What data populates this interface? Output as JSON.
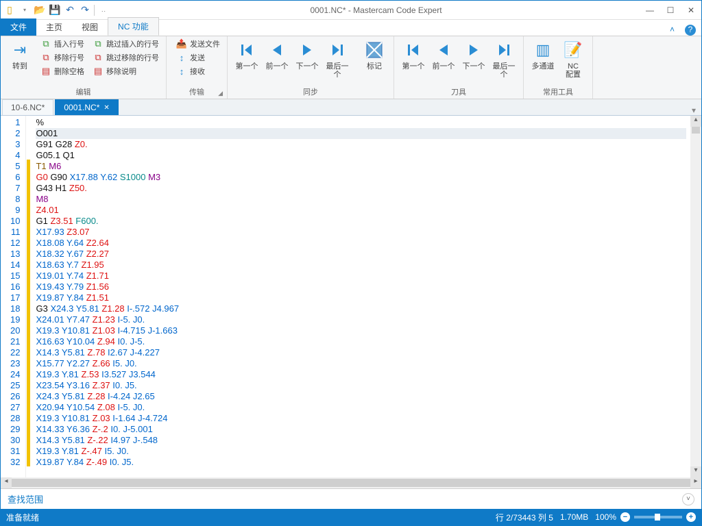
{
  "window": {
    "title": "0001.NC* - Mastercam Code Expert"
  },
  "ribbon_context_tab": "编辑",
  "ribbon_tabs": {
    "file": "文件",
    "home": "主页",
    "view": "视图",
    "nc": "NC 功能"
  },
  "ribbon": {
    "edit_group": {
      "label": "编辑",
      "goto": "转到",
      "insert_line": "插入行号",
      "skip_insert": "跳过插入的行号",
      "remove_line": "移除行号",
      "skip_remove": "跳过移除的行号",
      "remove_blank": "删除空格",
      "remove_comment": "移除说明"
    },
    "transfer_group": {
      "label": "传输",
      "send_file": "发送文件",
      "send": "发送",
      "receive": "接收"
    },
    "sync_group": {
      "label": "同步",
      "first": "第一个",
      "prev": "前一个",
      "next": "下一个",
      "last": "最后一个",
      "mark": "标记"
    },
    "tool_group": {
      "label": "刀具",
      "first": "第一个",
      "prev": "前一个",
      "next": "下一个",
      "last": "最后一个"
    },
    "common_group": {
      "label": "常用工具",
      "multichannel": "多通道",
      "nc_config": "NC\n配置"
    }
  },
  "doc_tabs": {
    "inactive": "10-6.NC*",
    "active": "0001.NC*"
  },
  "code_lines": [
    {
      "n": 1,
      "hl": false,
      "mk": false,
      "tokens": [
        {
          "t": "%",
          "c": ""
        }
      ]
    },
    {
      "n": 2,
      "hl": true,
      "mk": false,
      "tokens": [
        {
          "t": "O001",
          "c": ""
        }
      ]
    },
    {
      "n": 3,
      "hl": false,
      "mk": false,
      "tokens": [
        {
          "t": "G91 G28 ",
          "c": ""
        },
        {
          "t": "Z0.",
          "c": "red"
        }
      ]
    },
    {
      "n": 4,
      "hl": false,
      "mk": false,
      "tokens": [
        {
          "t": "G05.1 Q1",
          "c": ""
        }
      ]
    },
    {
      "n": 5,
      "hl": false,
      "mk": true,
      "tokens": [
        {
          "t": "T1 ",
          "c": "brown"
        },
        {
          "t": "M6",
          "c": "purple"
        }
      ]
    },
    {
      "n": 6,
      "hl": false,
      "mk": true,
      "tokens": [
        {
          "t": "G0 ",
          "c": "red"
        },
        {
          "t": "G90 ",
          "c": ""
        },
        {
          "t": "X17.88 Y.62 ",
          "c": "blue"
        },
        {
          "t": "S1000 ",
          "c": "teal"
        },
        {
          "t": "M3",
          "c": "purple"
        }
      ]
    },
    {
      "n": 7,
      "hl": false,
      "mk": true,
      "tokens": [
        {
          "t": "G43 H1 ",
          "c": ""
        },
        {
          "t": "Z50.",
          "c": "red"
        }
      ]
    },
    {
      "n": 8,
      "hl": false,
      "mk": true,
      "tokens": [
        {
          "t": "M8",
          "c": "purple"
        }
      ]
    },
    {
      "n": 9,
      "hl": false,
      "mk": true,
      "tokens": [
        {
          "t": "Z4.01",
          "c": "red"
        }
      ]
    },
    {
      "n": 10,
      "hl": false,
      "mk": true,
      "tokens": [
        {
          "t": "G1 ",
          "c": ""
        },
        {
          "t": "Z3.51 ",
          "c": "red"
        },
        {
          "t": "F600.",
          "c": "teal"
        }
      ]
    },
    {
      "n": 11,
      "hl": false,
      "mk": true,
      "tokens": [
        {
          "t": "X17.93 ",
          "c": "blue"
        },
        {
          "t": "Z3.07",
          "c": "red"
        }
      ]
    },
    {
      "n": 12,
      "hl": false,
      "mk": true,
      "tokens": [
        {
          "t": "X18.08 Y.64 ",
          "c": "blue"
        },
        {
          "t": "Z2.64",
          "c": "red"
        }
      ]
    },
    {
      "n": 13,
      "hl": false,
      "mk": true,
      "tokens": [
        {
          "t": "X18.32 Y.67 ",
          "c": "blue"
        },
        {
          "t": "Z2.27",
          "c": "red"
        }
      ]
    },
    {
      "n": 14,
      "hl": false,
      "mk": true,
      "tokens": [
        {
          "t": "X18.63 Y.7 ",
          "c": "blue"
        },
        {
          "t": "Z1.95",
          "c": "red"
        }
      ]
    },
    {
      "n": 15,
      "hl": false,
      "mk": true,
      "tokens": [
        {
          "t": "X19.01 Y.74 ",
          "c": "blue"
        },
        {
          "t": "Z1.71",
          "c": "red"
        }
      ]
    },
    {
      "n": 16,
      "hl": false,
      "mk": true,
      "tokens": [
        {
          "t": "X19.43 Y.79 ",
          "c": "blue"
        },
        {
          "t": "Z1.56",
          "c": "red"
        }
      ]
    },
    {
      "n": 17,
      "hl": false,
      "mk": true,
      "tokens": [
        {
          "t": "X19.87 Y.84 ",
          "c": "blue"
        },
        {
          "t": "Z1.51",
          "c": "red"
        }
      ]
    },
    {
      "n": 18,
      "hl": false,
      "mk": true,
      "tokens": [
        {
          "t": "G3 ",
          "c": ""
        },
        {
          "t": "X24.3 Y5.81 ",
          "c": "blue"
        },
        {
          "t": "Z1.28 ",
          "c": "red"
        },
        {
          "t": "I-.572 J4.967",
          "c": "blue"
        }
      ]
    },
    {
      "n": 19,
      "hl": false,
      "mk": true,
      "tokens": [
        {
          "t": "X24.01 Y7.47 ",
          "c": "blue"
        },
        {
          "t": "Z1.23 ",
          "c": "red"
        },
        {
          "t": "I-5. J0.",
          "c": "blue"
        }
      ]
    },
    {
      "n": 20,
      "hl": false,
      "mk": true,
      "tokens": [
        {
          "t": "X19.3 Y10.81 ",
          "c": "blue"
        },
        {
          "t": "Z1.03 ",
          "c": "red"
        },
        {
          "t": "I-4.715 J-1.663",
          "c": "blue"
        }
      ]
    },
    {
      "n": 21,
      "hl": false,
      "mk": true,
      "tokens": [
        {
          "t": "X16.63 Y10.04 ",
          "c": "blue"
        },
        {
          "t": "Z.94 ",
          "c": "red"
        },
        {
          "t": "I0. J-5.",
          "c": "blue"
        }
      ]
    },
    {
      "n": 22,
      "hl": false,
      "mk": true,
      "tokens": [
        {
          "t": "X14.3 Y5.81 ",
          "c": "blue"
        },
        {
          "t": "Z.78 ",
          "c": "red"
        },
        {
          "t": "I2.67 J-4.227",
          "c": "blue"
        }
      ]
    },
    {
      "n": 23,
      "hl": false,
      "mk": true,
      "tokens": [
        {
          "t": "X15.77 Y2.27 ",
          "c": "blue"
        },
        {
          "t": "Z.66 ",
          "c": "red"
        },
        {
          "t": "I5. J0.",
          "c": "blue"
        }
      ]
    },
    {
      "n": 24,
      "hl": false,
      "mk": true,
      "tokens": [
        {
          "t": "X19.3 Y.81 ",
          "c": "blue"
        },
        {
          "t": "Z.53 ",
          "c": "red"
        },
        {
          "t": "I3.527 J3.544",
          "c": "blue"
        }
      ]
    },
    {
      "n": 25,
      "hl": false,
      "mk": true,
      "tokens": [
        {
          "t": "X23.54 Y3.16 ",
          "c": "blue"
        },
        {
          "t": "Z.37 ",
          "c": "red"
        },
        {
          "t": "I0. J5.",
          "c": "blue"
        }
      ]
    },
    {
      "n": 26,
      "hl": false,
      "mk": true,
      "tokens": [
        {
          "t": "X24.3 Y5.81 ",
          "c": "blue"
        },
        {
          "t": "Z.28 ",
          "c": "red"
        },
        {
          "t": "I-4.24 J2.65",
          "c": "blue"
        }
      ]
    },
    {
      "n": 27,
      "hl": false,
      "mk": true,
      "tokens": [
        {
          "t": "X20.94 Y10.54 ",
          "c": "blue"
        },
        {
          "t": "Z.08 ",
          "c": "red"
        },
        {
          "t": "I-5. J0.",
          "c": "blue"
        }
      ]
    },
    {
      "n": 28,
      "hl": false,
      "mk": true,
      "tokens": [
        {
          "t": "X19.3 Y10.81 ",
          "c": "blue"
        },
        {
          "t": "Z.03 ",
          "c": "red"
        },
        {
          "t": "I-1.64 J-4.724",
          "c": "blue"
        }
      ]
    },
    {
      "n": 29,
      "hl": false,
      "mk": true,
      "tokens": [
        {
          "t": "X14.33 Y6.36 ",
          "c": "blue"
        },
        {
          "t": "Z-.2 ",
          "c": "red"
        },
        {
          "t": "I0. J-5.001",
          "c": "blue"
        }
      ]
    },
    {
      "n": 30,
      "hl": false,
      "mk": true,
      "tokens": [
        {
          "t": "X14.3 Y5.81 ",
          "c": "blue"
        },
        {
          "t": "Z-.22 ",
          "c": "red"
        },
        {
          "t": "I4.97 J-.548",
          "c": "blue"
        }
      ]
    },
    {
      "n": 31,
      "hl": false,
      "mk": true,
      "tokens": [
        {
          "t": "X19.3 Y.81 ",
          "c": "blue"
        },
        {
          "t": "Z-.47 ",
          "c": "red"
        },
        {
          "t": "I5. J0.",
          "c": "blue"
        }
      ]
    },
    {
      "n": 32,
      "hl": false,
      "mk": true,
      "tokens": [
        {
          "t": "X19.87 Y.84 ",
          "c": "blue"
        },
        {
          "t": "Z-.49 ",
          "c": "red"
        },
        {
          "t": "I0. J5.",
          "c": "blue"
        }
      ]
    }
  ],
  "findbar": {
    "label": "查找范围"
  },
  "status": {
    "ready": "准备就绪",
    "pos": "行 2/73443  列 5",
    "size": "1.70MB",
    "zoom": "100%"
  }
}
